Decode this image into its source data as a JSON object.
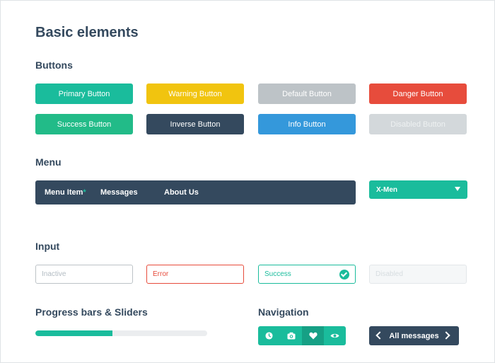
{
  "page_title": "Basic elements",
  "sections": {
    "buttons": "Buttons",
    "menu": "Menu",
    "input": "Input",
    "progress": "Progress bars & Sliders",
    "navigation": "Navigation"
  },
  "buttons": {
    "primary": "Primary Button",
    "warning": "Warning Button",
    "default": "Default Button",
    "danger": "Danger Button",
    "success": "Success Button",
    "inverse": "Inverse Button",
    "info": "Info Button",
    "disabled": "Disabled Button"
  },
  "menu": {
    "items": [
      "Menu Item",
      "Messages",
      "About Us"
    ],
    "badge_mark": "*",
    "dropdown_value": "X-Men"
  },
  "inputs": {
    "inactive_placeholder": "Inactive",
    "error_value": "Error",
    "success_value": "Success",
    "disabled_placeholder": "Disabled"
  },
  "progress": {
    "value_percent": 45
  },
  "navigation": {
    "icons": [
      "clock-icon",
      "camera-icon",
      "heart-icon",
      "eye-icon"
    ],
    "active_index": 2,
    "pager_label": "All messages"
  },
  "colors": {
    "turquoise": "#1abc9c",
    "yellow": "#f1c40f",
    "silver": "#bdc3c7",
    "red": "#e74c3c",
    "navy": "#34495e",
    "blue": "#3498db"
  }
}
